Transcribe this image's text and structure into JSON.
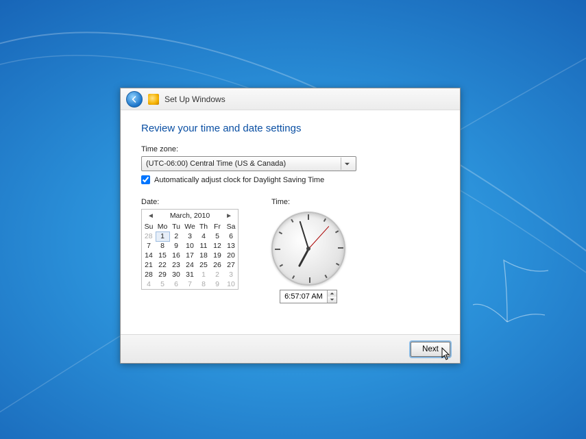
{
  "window": {
    "title": "Set Up Windows"
  },
  "page": {
    "heading": "Review your time and date settings",
    "timezone_label": "Time zone:",
    "timezone_value": "(UTC-06:00) Central Time (US & Canada)",
    "dst_label": "Automatically adjust clock for Daylight Saving Time",
    "dst_checked": true,
    "date_label": "Date:",
    "time_label": "Time:",
    "next_label": "Next"
  },
  "calendar": {
    "title": "March, 2010",
    "dow": [
      "Su",
      "Mo",
      "Tu",
      "We",
      "Th",
      "Fr",
      "Sa"
    ],
    "weeks": [
      [
        {
          "d": "28",
          "dim": true
        },
        {
          "d": "1",
          "sel": true
        },
        {
          "d": "2"
        },
        {
          "d": "3"
        },
        {
          "d": "4"
        },
        {
          "d": "5"
        },
        {
          "d": "6"
        }
      ],
      [
        {
          "d": "7"
        },
        {
          "d": "8"
        },
        {
          "d": "9"
        },
        {
          "d": "10"
        },
        {
          "d": "11"
        },
        {
          "d": "12"
        },
        {
          "d": "13"
        }
      ],
      [
        {
          "d": "14"
        },
        {
          "d": "15"
        },
        {
          "d": "16"
        },
        {
          "d": "17"
        },
        {
          "d": "18"
        },
        {
          "d": "19"
        },
        {
          "d": "20"
        }
      ],
      [
        {
          "d": "21"
        },
        {
          "d": "22"
        },
        {
          "d": "23"
        },
        {
          "d": "24"
        },
        {
          "d": "25"
        },
        {
          "d": "26"
        },
        {
          "d": "27"
        }
      ],
      [
        {
          "d": "28"
        },
        {
          "d": "29"
        },
        {
          "d": "30"
        },
        {
          "d": "31"
        },
        {
          "d": "1",
          "dim": true
        },
        {
          "d": "2",
          "dim": true
        },
        {
          "d": "3",
          "dim": true
        }
      ],
      [
        {
          "d": "4",
          "dim": true
        },
        {
          "d": "5",
          "dim": true
        },
        {
          "d": "6",
          "dim": true
        },
        {
          "d": "7",
          "dim": true
        },
        {
          "d": "8",
          "dim": true
        },
        {
          "d": "9",
          "dim": true
        },
        {
          "d": "10",
          "dim": true
        }
      ]
    ]
  },
  "clock": {
    "time_text": "6:57:07 AM",
    "hour": 6,
    "minute": 57,
    "second": 7
  }
}
